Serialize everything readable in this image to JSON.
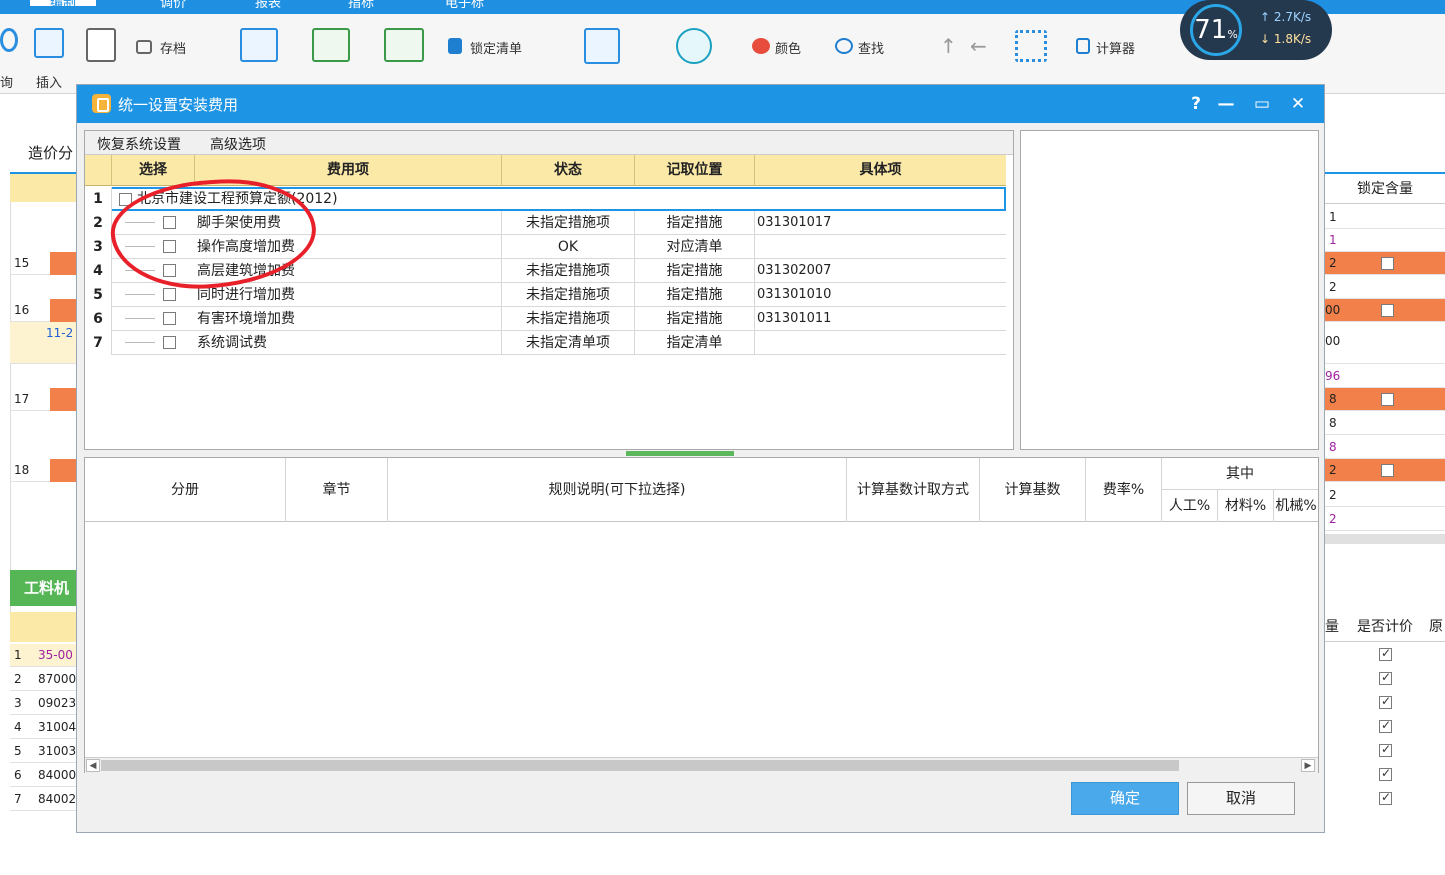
{
  "background_app": {
    "tabs": [
      "编制",
      "调价",
      "报表",
      "指标",
      "电子标"
    ],
    "ribbon": {
      "save_label": "存档",
      "lock_list_label": "锁定清单",
      "color_label": "颜色",
      "find_label": "查找",
      "calculator_label": "计算器",
      "query_label": "询",
      "insert_label": "插入"
    },
    "network_speed": {
      "percent": "71",
      "percent_unit": "%",
      "upload": "2.7K/s",
      "download": "1.8K/s"
    },
    "left_tab_label": "造价分",
    "left_row_numbers": [
      "15",
      "16",
      "17",
      "18"
    ],
    "left_cell_text": "11-2",
    "left_bottom_tab": "工料机",
    "left_bottom_rows": [
      {
        "num": "1",
        "code": "35-00"
      },
      {
        "num": "2",
        "code": "87000"
      },
      {
        "num": "3",
        "code": "09023"
      },
      {
        "num": "4",
        "code": "31004"
      },
      {
        "num": "5",
        "code": "31003"
      },
      {
        "num": "6",
        "code": "84000"
      },
      {
        "num": "7",
        "code": "84002"
      }
    ],
    "right_header": "锁定含量",
    "right_values": [
      "1",
      "1",
      "2",
      "2",
      "00",
      "00",
      "96",
      "8",
      "8",
      "8",
      "2",
      "2",
      "2"
    ],
    "right_bottom_headers": [
      "量",
      "是否计价",
      "原"
    ]
  },
  "dialog": {
    "title": "统一设置安装费用",
    "help": "?",
    "toolbar": {
      "restore_label": "恢复系统设置",
      "advanced_label": "高级选项"
    },
    "columns": {
      "select": "选择",
      "item": "费用项",
      "status": "状态",
      "position": "记取位置",
      "specific": "具体项"
    },
    "rows": [
      {
        "num": "1",
        "item": "北京市建设工程预算定额(2012)",
        "status": "",
        "position": "",
        "specific": ""
      },
      {
        "num": "2",
        "item": "脚手架使用费",
        "status": "未指定措施项",
        "position": "指定措施",
        "specific": "031301017"
      },
      {
        "num": "3",
        "item": "操作高度增加费",
        "status": "OK",
        "position": "对应清单",
        "specific": ""
      },
      {
        "num": "4",
        "item": "高层建筑增加费",
        "status": "未指定措施项",
        "position": "指定措施",
        "specific": "031302007"
      },
      {
        "num": "5",
        "item": "同时进行增加费",
        "status": "未指定措施项",
        "position": "指定措施",
        "specific": "031301010"
      },
      {
        "num": "6",
        "item": "有害环境增加费",
        "status": "未指定措施项",
        "position": "指定措施",
        "specific": "031301011"
      },
      {
        "num": "7",
        "item": "系统调试费",
        "status": "未指定清单项",
        "position": "指定清单",
        "specific": ""
      }
    ],
    "lower_columns": {
      "volume": "分册",
      "chapter": "章节",
      "rule": "规则说明(可下拉选择)",
      "base_method": "计算基数计取方式",
      "base": "计算基数",
      "rate": "费率%",
      "among": "其中",
      "labor": "人工%",
      "material": "材料%",
      "machine": "机械%"
    },
    "ok_label": "确定",
    "cancel_label": "取消"
  },
  "colors": {
    "title_bar": "#1e94e4",
    "header_yellow": "#fbe9a8",
    "annotation_red": "#e8202a",
    "ok_button": "#4aa9ea",
    "orange_row": "#f2804a"
  }
}
